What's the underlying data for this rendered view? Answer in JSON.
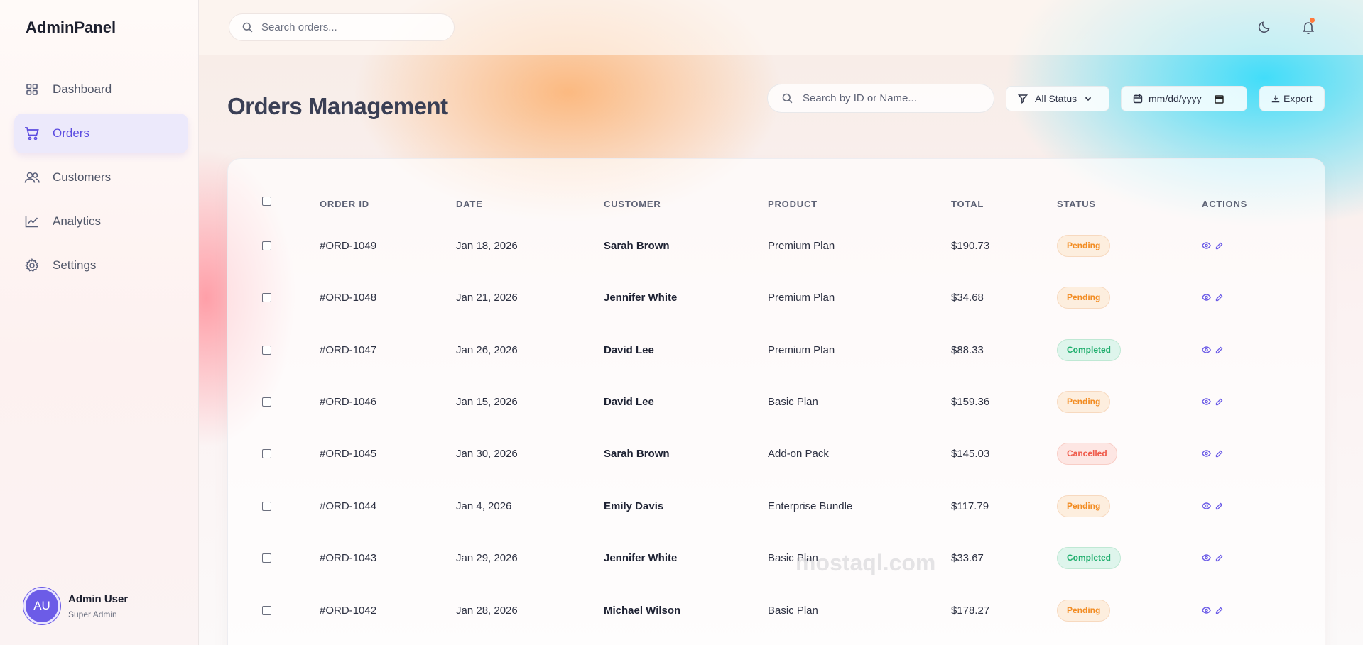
{
  "brand": "AdminPanel",
  "sidebar": {
    "items": [
      {
        "label": "Dashboard",
        "icon": "grid-icon"
      },
      {
        "label": "Orders",
        "icon": "cart-icon",
        "active": true
      },
      {
        "label": "Customers",
        "icon": "users-icon"
      },
      {
        "label": "Analytics",
        "icon": "chart-line-icon"
      },
      {
        "label": "Settings",
        "icon": "gear-icon"
      }
    ]
  },
  "user": {
    "initials": "AU",
    "name": "Admin User",
    "role": "Super Admin"
  },
  "topbar": {
    "search_placeholder": "Search orders..."
  },
  "page": {
    "title": "Orders Management",
    "search_placeholder": "Search by ID or Name...",
    "status_filter": "All Status",
    "date_placeholder": "mm/dd/yyyy",
    "export_label": "Export"
  },
  "table": {
    "headers": [
      "ORDER ID",
      "DATE",
      "CUSTOMER",
      "PRODUCT",
      "TOTAL",
      "STATUS",
      "ACTIONS"
    ],
    "rows": [
      {
        "id": "#ORD-1049",
        "date": "Jan 18, 2026",
        "customer": "Sarah Brown",
        "product": "Premium Plan",
        "total": "$190.73",
        "status": "Pending"
      },
      {
        "id": "#ORD-1048",
        "date": "Jan 21, 2026",
        "customer": "Jennifer White",
        "product": "Premium Plan",
        "total": "$34.68",
        "status": "Pending"
      },
      {
        "id": "#ORD-1047",
        "date": "Jan 26, 2026",
        "customer": "David Lee",
        "product": "Premium Plan",
        "total": "$88.33",
        "status": "Completed"
      },
      {
        "id": "#ORD-1046",
        "date": "Jan 15, 2026",
        "customer": "David Lee",
        "product": "Basic Plan",
        "total": "$159.36",
        "status": "Pending"
      },
      {
        "id": "#ORD-1045",
        "date": "Jan 30, 2026",
        "customer": "Sarah Brown",
        "product": "Add-on Pack",
        "total": "$145.03",
        "status": "Cancelled"
      },
      {
        "id": "#ORD-1044",
        "date": "Jan 4, 2026",
        "customer": "Emily Davis",
        "product": "Enterprise Bundle",
        "total": "$117.79",
        "status": "Pending"
      },
      {
        "id": "#ORD-1043",
        "date": "Jan 29, 2026",
        "customer": "Jennifer White",
        "product": "Basic Plan",
        "total": "$33.67",
        "status": "Completed"
      },
      {
        "id": "#ORD-1042",
        "date": "Jan 28, 2026",
        "customer": "Michael Wilson",
        "product": "Basic Plan",
        "total": "$178.27",
        "status": "Pending"
      }
    ]
  },
  "watermark": "mostaql.com",
  "colors": {
    "accent": "#6c5ce7",
    "pending": "#f28c22",
    "completed": "#1fae6d",
    "cancelled": "#ef5b4b"
  }
}
